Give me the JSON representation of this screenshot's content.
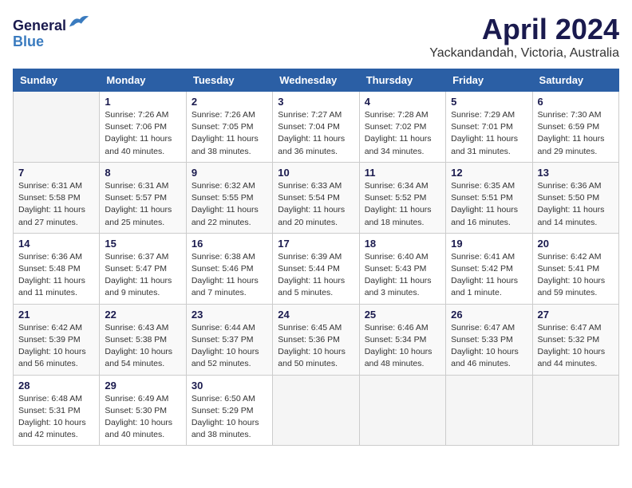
{
  "header": {
    "logo_line1": "General",
    "logo_line2": "Blue",
    "month_title": "April 2024",
    "location": "Yackandandah, Victoria, Australia"
  },
  "calendar": {
    "weekdays": [
      "Sunday",
      "Monday",
      "Tuesday",
      "Wednesday",
      "Thursday",
      "Friday",
      "Saturday"
    ],
    "rows": [
      [
        {
          "day": "",
          "sunrise": "",
          "sunset": "",
          "daylight": "",
          "empty": true
        },
        {
          "day": "1",
          "sunrise": "Sunrise: 7:26 AM",
          "sunset": "Sunset: 7:06 PM",
          "daylight": "Daylight: 11 hours and 40 minutes.",
          "empty": false
        },
        {
          "day": "2",
          "sunrise": "Sunrise: 7:26 AM",
          "sunset": "Sunset: 7:05 PM",
          "daylight": "Daylight: 11 hours and 38 minutes.",
          "empty": false
        },
        {
          "day": "3",
          "sunrise": "Sunrise: 7:27 AM",
          "sunset": "Sunset: 7:04 PM",
          "daylight": "Daylight: 11 hours and 36 minutes.",
          "empty": false
        },
        {
          "day": "4",
          "sunrise": "Sunrise: 7:28 AM",
          "sunset": "Sunset: 7:02 PM",
          "daylight": "Daylight: 11 hours and 34 minutes.",
          "empty": false
        },
        {
          "day": "5",
          "sunrise": "Sunrise: 7:29 AM",
          "sunset": "Sunset: 7:01 PM",
          "daylight": "Daylight: 11 hours and 31 minutes.",
          "empty": false
        },
        {
          "day": "6",
          "sunrise": "Sunrise: 7:30 AM",
          "sunset": "Sunset: 6:59 PM",
          "daylight": "Daylight: 11 hours and 29 minutes.",
          "empty": false
        }
      ],
      [
        {
          "day": "7",
          "sunrise": "Sunrise: 6:31 AM",
          "sunset": "Sunset: 5:58 PM",
          "daylight": "Daylight: 11 hours and 27 minutes.",
          "empty": false
        },
        {
          "day": "8",
          "sunrise": "Sunrise: 6:31 AM",
          "sunset": "Sunset: 5:57 PM",
          "daylight": "Daylight: 11 hours and 25 minutes.",
          "empty": false
        },
        {
          "day": "9",
          "sunrise": "Sunrise: 6:32 AM",
          "sunset": "Sunset: 5:55 PM",
          "daylight": "Daylight: 11 hours and 22 minutes.",
          "empty": false
        },
        {
          "day": "10",
          "sunrise": "Sunrise: 6:33 AM",
          "sunset": "Sunset: 5:54 PM",
          "daylight": "Daylight: 11 hours and 20 minutes.",
          "empty": false
        },
        {
          "day": "11",
          "sunrise": "Sunrise: 6:34 AM",
          "sunset": "Sunset: 5:52 PM",
          "daylight": "Daylight: 11 hours and 18 minutes.",
          "empty": false
        },
        {
          "day": "12",
          "sunrise": "Sunrise: 6:35 AM",
          "sunset": "Sunset: 5:51 PM",
          "daylight": "Daylight: 11 hours and 16 minutes.",
          "empty": false
        },
        {
          "day": "13",
          "sunrise": "Sunrise: 6:36 AM",
          "sunset": "Sunset: 5:50 PM",
          "daylight": "Daylight: 11 hours and 14 minutes.",
          "empty": false
        }
      ],
      [
        {
          "day": "14",
          "sunrise": "Sunrise: 6:36 AM",
          "sunset": "Sunset: 5:48 PM",
          "daylight": "Daylight: 11 hours and 11 minutes.",
          "empty": false
        },
        {
          "day": "15",
          "sunrise": "Sunrise: 6:37 AM",
          "sunset": "Sunset: 5:47 PM",
          "daylight": "Daylight: 11 hours and 9 minutes.",
          "empty": false
        },
        {
          "day": "16",
          "sunrise": "Sunrise: 6:38 AM",
          "sunset": "Sunset: 5:46 PM",
          "daylight": "Daylight: 11 hours and 7 minutes.",
          "empty": false
        },
        {
          "day": "17",
          "sunrise": "Sunrise: 6:39 AM",
          "sunset": "Sunset: 5:44 PM",
          "daylight": "Daylight: 11 hours and 5 minutes.",
          "empty": false
        },
        {
          "day": "18",
          "sunrise": "Sunrise: 6:40 AM",
          "sunset": "Sunset: 5:43 PM",
          "daylight": "Daylight: 11 hours and 3 minutes.",
          "empty": false
        },
        {
          "day": "19",
          "sunrise": "Sunrise: 6:41 AM",
          "sunset": "Sunset: 5:42 PM",
          "daylight": "Daylight: 11 hours and 1 minute.",
          "empty": false
        },
        {
          "day": "20",
          "sunrise": "Sunrise: 6:42 AM",
          "sunset": "Sunset: 5:41 PM",
          "daylight": "Daylight: 10 hours and 59 minutes.",
          "empty": false
        }
      ],
      [
        {
          "day": "21",
          "sunrise": "Sunrise: 6:42 AM",
          "sunset": "Sunset: 5:39 PM",
          "daylight": "Daylight: 10 hours and 56 minutes.",
          "empty": false
        },
        {
          "day": "22",
          "sunrise": "Sunrise: 6:43 AM",
          "sunset": "Sunset: 5:38 PM",
          "daylight": "Daylight: 10 hours and 54 minutes.",
          "empty": false
        },
        {
          "day": "23",
          "sunrise": "Sunrise: 6:44 AM",
          "sunset": "Sunset: 5:37 PM",
          "daylight": "Daylight: 10 hours and 52 minutes.",
          "empty": false
        },
        {
          "day": "24",
          "sunrise": "Sunrise: 6:45 AM",
          "sunset": "Sunset: 5:36 PM",
          "daylight": "Daylight: 10 hours and 50 minutes.",
          "empty": false
        },
        {
          "day": "25",
          "sunrise": "Sunrise: 6:46 AM",
          "sunset": "Sunset: 5:34 PM",
          "daylight": "Daylight: 10 hours and 48 minutes.",
          "empty": false
        },
        {
          "day": "26",
          "sunrise": "Sunrise: 6:47 AM",
          "sunset": "Sunset: 5:33 PM",
          "daylight": "Daylight: 10 hours and 46 minutes.",
          "empty": false
        },
        {
          "day": "27",
          "sunrise": "Sunrise: 6:47 AM",
          "sunset": "Sunset: 5:32 PM",
          "daylight": "Daylight: 10 hours and 44 minutes.",
          "empty": false
        }
      ],
      [
        {
          "day": "28",
          "sunrise": "Sunrise: 6:48 AM",
          "sunset": "Sunset: 5:31 PM",
          "daylight": "Daylight: 10 hours and 42 minutes.",
          "empty": false
        },
        {
          "day": "29",
          "sunrise": "Sunrise: 6:49 AM",
          "sunset": "Sunset: 5:30 PM",
          "daylight": "Daylight: 10 hours and 40 minutes.",
          "empty": false
        },
        {
          "day": "30",
          "sunrise": "Sunrise: 6:50 AM",
          "sunset": "Sunset: 5:29 PM",
          "daylight": "Daylight: 10 hours and 38 minutes.",
          "empty": false
        },
        {
          "day": "",
          "sunrise": "",
          "sunset": "",
          "daylight": "",
          "empty": true
        },
        {
          "day": "",
          "sunrise": "",
          "sunset": "",
          "daylight": "",
          "empty": true
        },
        {
          "day": "",
          "sunrise": "",
          "sunset": "",
          "daylight": "",
          "empty": true
        },
        {
          "day": "",
          "sunrise": "",
          "sunset": "",
          "daylight": "",
          "empty": true
        }
      ]
    ]
  }
}
